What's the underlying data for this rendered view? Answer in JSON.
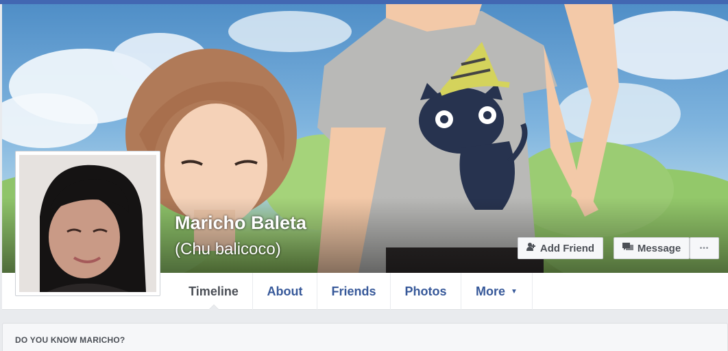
{
  "profile": {
    "name": "Maricho Baleta",
    "alternate_name": "(Chu balicoco)"
  },
  "actions": {
    "add_friend": "Add Friend",
    "message": "Message",
    "more": "•••"
  },
  "tabs": [
    {
      "label": "Timeline",
      "active": true
    },
    {
      "label": "About",
      "active": false
    },
    {
      "label": "Friends",
      "active": false
    },
    {
      "label": "Photos",
      "active": false
    },
    {
      "label": "More",
      "active": false
    }
  ],
  "more_caret": "▼",
  "card": {
    "title": "DO YOU KNOW MARICHO?"
  },
  "colors": {
    "brand": "#4267b2",
    "link": "#365899",
    "text": "#4b4f56"
  },
  "icons": {
    "add_friend": "add-friend-icon",
    "message": "message-icon"
  }
}
